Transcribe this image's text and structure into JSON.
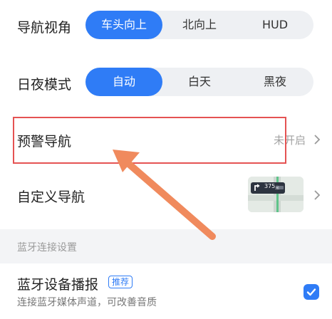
{
  "nav_view": {
    "label": "导航视角",
    "options": [
      "车头向上",
      "北向上",
      "HUD"
    ],
    "selected": "车头向上"
  },
  "day_night": {
    "label": "日夜模式",
    "options": [
      "自动",
      "白天",
      "黑夜"
    ],
    "selected": "自动"
  },
  "warning_nav": {
    "label": "预警导航",
    "status": "未开启"
  },
  "custom_nav": {
    "label": "自定义导航",
    "preview_distance": "375",
    "preview_unit": "米"
  },
  "bluetooth_section": {
    "title": "蓝牙连接设置"
  },
  "bluetooth_broadcast": {
    "label": "蓝牙设备播报",
    "badge": "推荐",
    "subtitle": "连接蓝牙媒体声道，可改善音质",
    "checked": true
  },
  "colors": {
    "accent": "#2f7cf6",
    "annotation": "#e55353",
    "arrow": "#f08a5d"
  }
}
